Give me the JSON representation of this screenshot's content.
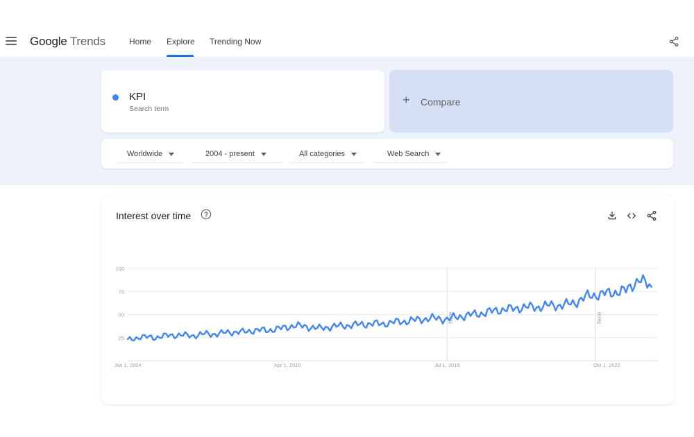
{
  "header": {
    "logo_google": "Google",
    "logo_trends": "Trends",
    "tabs": [
      {
        "label": "Home"
      },
      {
        "label": "Explore"
      },
      {
        "label": "Trending Now"
      }
    ]
  },
  "search": {
    "term": "KPI",
    "term_type": "Search term",
    "compare_label": "Compare"
  },
  "filters": {
    "region": "Worldwide",
    "time": "2004 - present",
    "category": "All categories",
    "property": "Web Search"
  },
  "chart_card": {
    "title": "Interest over time"
  },
  "chart_data": {
    "type": "line",
    "title": "Interest over time",
    "ylim": [
      0,
      100
    ],
    "y_ticks": [
      "100",
      "75",
      "50",
      "25"
    ],
    "x_ticks": [
      "Jan 1, 2004",
      "Apr 1, 2010",
      "Jul 1, 2016",
      "Oct 1, 2022"
    ],
    "annotations": [
      "Note",
      "Note"
    ],
    "grid": true,
    "series": [
      {
        "color": "#4285f4",
        "x": [
          "2004-01",
          "2004-07",
          "2005-01",
          "2005-07",
          "2006-01",
          "2006-07",
          "2007-01",
          "2007-07",
          "2008-01",
          "2008-07",
          "2009-01",
          "2009-07",
          "2010-01",
          "2010-07",
          "2011-01",
          "2011-07",
          "2012-01",
          "2012-07",
          "2013-01",
          "2013-07",
          "2014-01",
          "2014-07",
          "2015-01",
          "2015-07",
          "2016-01",
          "2016-07",
          "2017-01",
          "2017-07",
          "2018-01",
          "2018-07",
          "2019-01",
          "2019-07",
          "2020-01",
          "2020-07",
          "2021-01",
          "2021-07",
          "2022-01",
          "2022-07",
          "2023-01",
          "2023-07",
          "2024-01",
          "2024-07"
        ],
        "values": [
          22,
          26,
          25,
          27,
          28,
          27,
          29,
          29,
          31,
          31,
          33,
          33,
          35,
          38,
          37,
          35,
          37,
          38,
          39,
          40,
          40,
          42,
          43,
          45,
          46,
          45,
          48,
          50,
          52,
          55,
          56,
          58,
          58,
          60,
          60,
          63,
          70,
          72,
          74,
          76,
          88,
          80
        ]
      }
    ]
  }
}
